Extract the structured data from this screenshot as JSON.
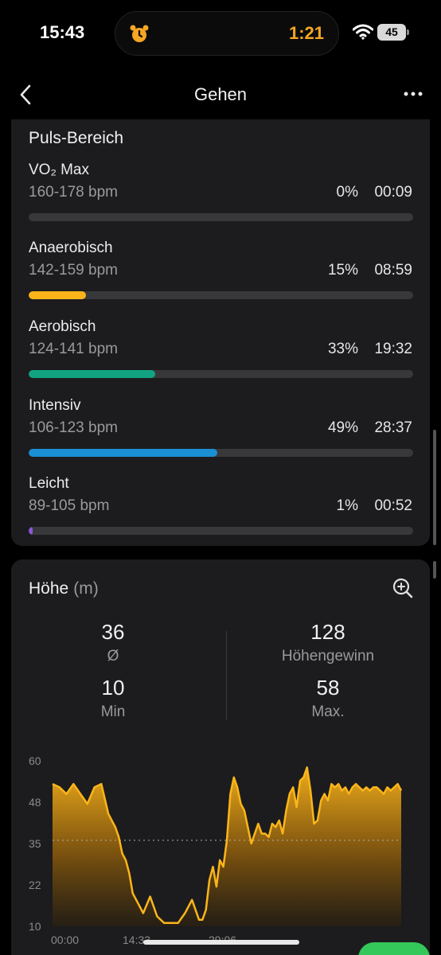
{
  "status_bar": {
    "time": "15:43",
    "timer": "1:21",
    "battery": "45"
  },
  "header": {
    "title": "Gehen"
  },
  "heart_rate": {
    "title": "Puls-Bereich",
    "zones": [
      {
        "name": "VO₂ Max",
        "range": "160-178 bpm",
        "percent": "0%",
        "time": "00:09",
        "fill": 0.0,
        "color": "#e24f3f"
      },
      {
        "name": "Anaerobisch",
        "range": "142-159 bpm",
        "percent": "15%",
        "time": "08:59",
        "fill": 0.15,
        "color": "#fbb51a"
      },
      {
        "name": "Aerobisch",
        "range": "124-141 bpm",
        "percent": "33%",
        "time": "19:32",
        "fill": 0.33,
        "color": "#11a382"
      },
      {
        "name": "Intensiv",
        "range": "106-123 bpm",
        "percent": "49%",
        "time": "28:37",
        "fill": 0.49,
        "color": "#1b8fd4"
      },
      {
        "name": "Leicht",
        "range": "89-105 bpm",
        "percent": "1%",
        "time": "00:52",
        "fill": 0.01,
        "color": "#8a57d6"
      }
    ]
  },
  "altitude": {
    "title": "Höhe",
    "unit": "(m)",
    "stats": {
      "avg": {
        "value": "36",
        "label": "Ø"
      },
      "gain": {
        "value": "128",
        "label": "Höhengewinn"
      },
      "min": {
        "value": "10",
        "label": "Min"
      },
      "max": {
        "value": "58",
        "label": "Max."
      }
    }
  },
  "chart_data": {
    "type": "area",
    "yticks": [
      "60",
      "48",
      "35",
      "22",
      "10"
    ],
    "ylim": [
      10,
      60
    ],
    "xticks": [
      "00:00",
      "14:33",
      "29:06"
    ],
    "xlim": [
      0,
      100
    ],
    "avg_line": 36,
    "color": "#fbb51a",
    "x": [
      0,
      2,
      4,
      6,
      8,
      10,
      12,
      14,
      16,
      18,
      19,
      20,
      21,
      22,
      23,
      24,
      26,
      28,
      30,
      32,
      34,
      36,
      38,
      40,
      42,
      43,
      44,
      45,
      46,
      47,
      48,
      49,
      50,
      51,
      52,
      53,
      54,
      55,
      56,
      57,
      58,
      59,
      60,
      61,
      62,
      63,
      64,
      65,
      66,
      67,
      68,
      69,
      70,
      71,
      72,
      73,
      74,
      75,
      76,
      77,
      78,
      79,
      80,
      81,
      82,
      83,
      84,
      85,
      86,
      87,
      88,
      89,
      90,
      91,
      92,
      93,
      94,
      95,
      96,
      97,
      98,
      99,
      100
    ],
    "y": [
      53,
      52,
      50,
      53,
      50,
      47,
      52,
      53,
      44,
      40,
      37,
      32,
      30,
      26,
      20,
      18,
      14,
      19,
      13,
      11,
      11,
      11,
      14,
      18,
      12,
      12,
      15,
      24,
      28,
      22,
      30,
      28,
      36,
      50,
      55,
      52,
      47,
      45,
      40,
      35,
      38,
      41,
      38,
      38,
      37,
      41,
      40,
      42,
      38,
      45,
      50,
      52,
      46,
      54,
      55,
      58,
      51,
      41,
      42,
      48,
      50,
      48,
      53,
      52,
      53,
      51,
      52,
      50,
      52,
      53,
      52,
      51,
      52,
      51,
      52,
      52,
      51,
      50,
      52,
      51,
      52,
      53,
      51
    ]
  }
}
